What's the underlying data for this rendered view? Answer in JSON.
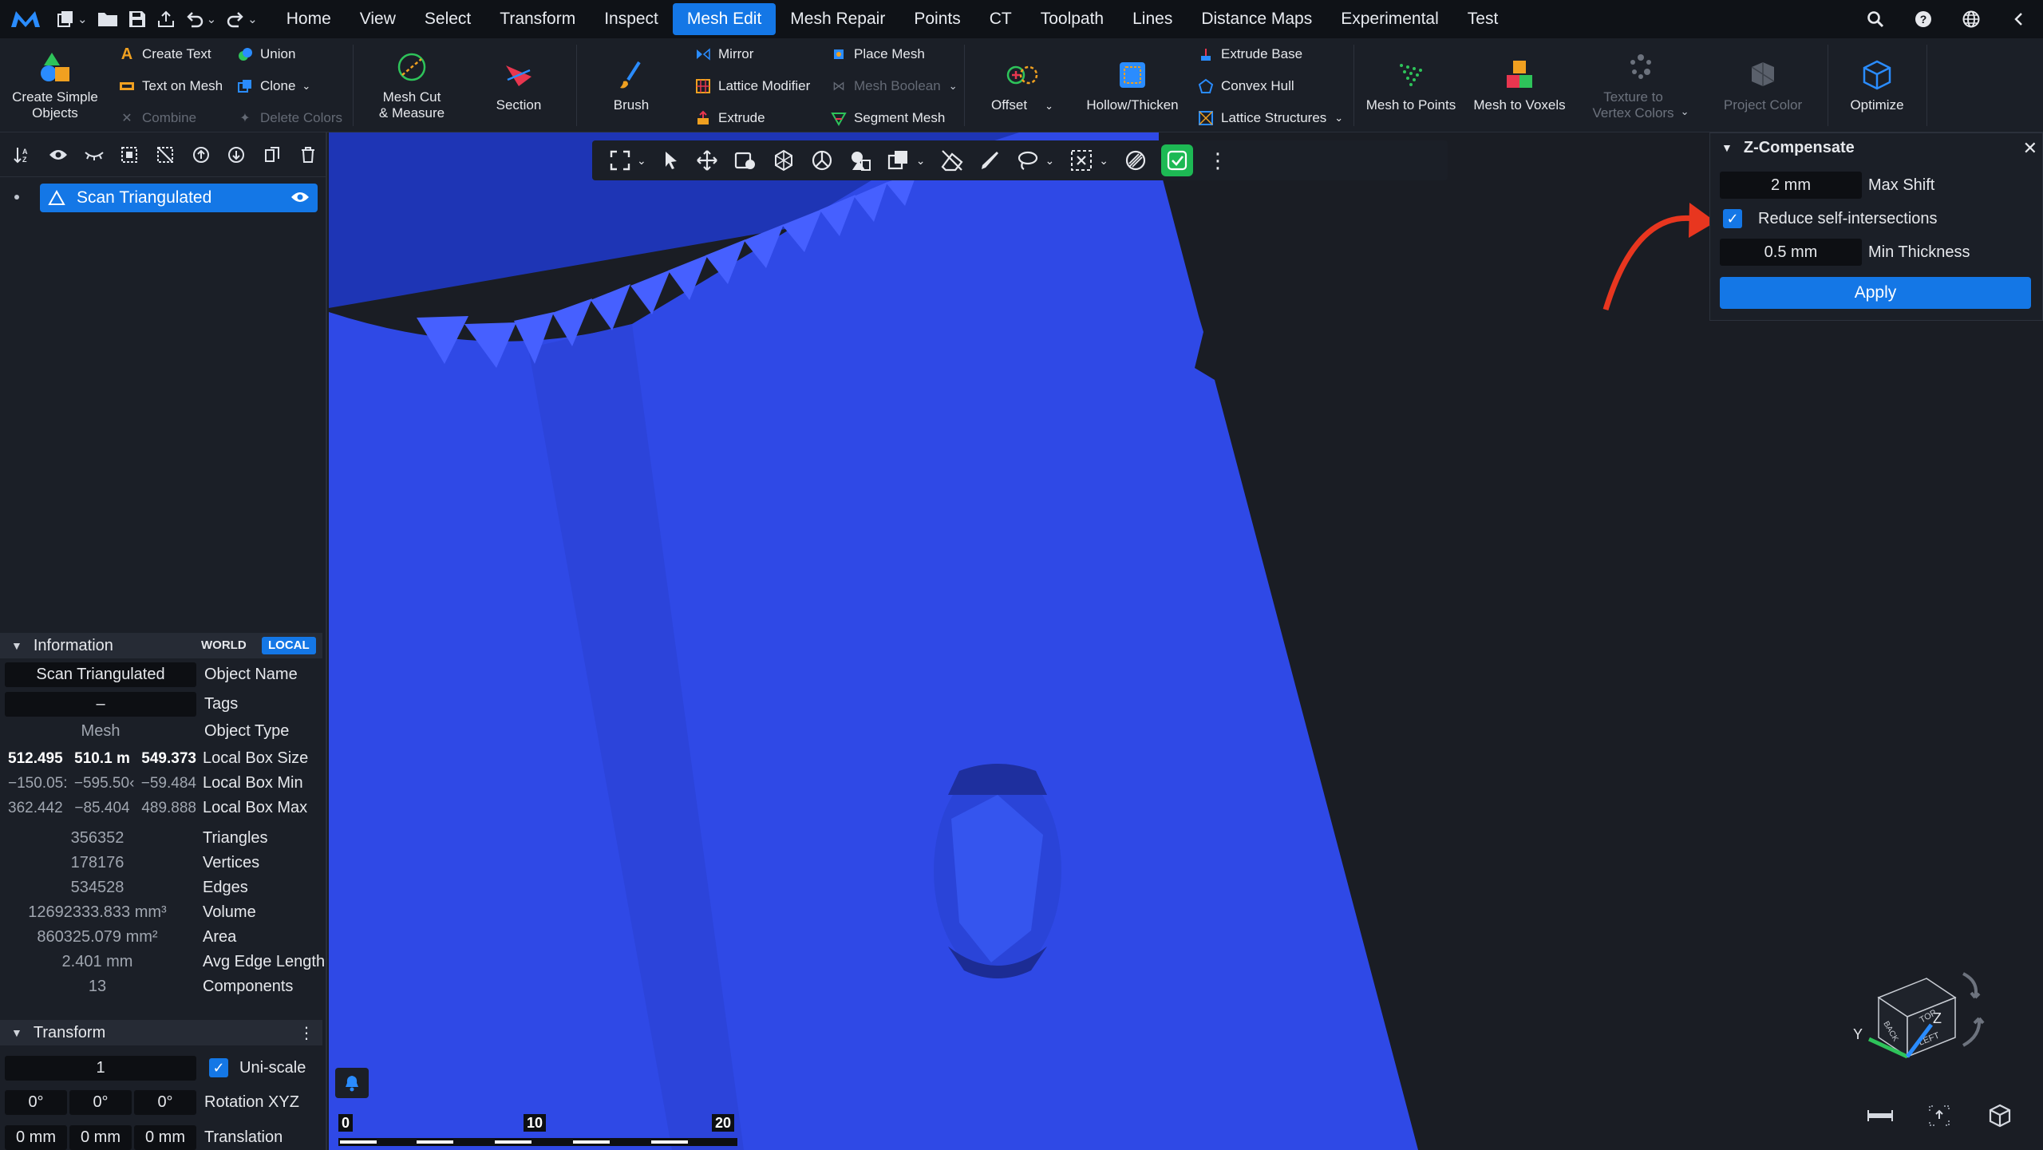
{
  "menu": {
    "tabs": [
      "Home",
      "View",
      "Select",
      "Transform",
      "Inspect",
      "Mesh Edit",
      "Mesh Repair",
      "Points",
      "CT",
      "Toolpath",
      "Lines",
      "Distance Maps",
      "Experimental",
      "Test"
    ],
    "active_tab": "Mesh Edit",
    "right_icons": [
      "search-icon",
      "help-icon",
      "globe-icon",
      "collapse-icon"
    ]
  },
  "ribbon": {
    "create_simple_objects": "Create Simple\nObjects",
    "create_text": "Create Text",
    "text_on_mesh": "Text on Mesh",
    "combine": "Combine",
    "union": "Union",
    "clone": "Clone",
    "delete_colors": "Delete Colors",
    "mesh_cut": "Mesh Cut\n& Measure",
    "section": "Section",
    "brush": "Brush",
    "mirror": "Mirror",
    "lattice_modifier": "Lattice Modifier",
    "extrude": "Extrude",
    "place_mesh": "Place Mesh",
    "mesh_boolean": "Mesh Boolean",
    "segment_mesh": "Segment Mesh",
    "offset": "Offset",
    "hollow_thicken": "Hollow/Thicken",
    "extrude_base": "Extrude Base",
    "convex_hull": "Convex Hull",
    "lattice_structures": "Lattice Structures",
    "mesh_to_points": "Mesh to Points",
    "mesh_to_voxels": "Mesh to Voxels",
    "texture_to_vertex_colors": "Texture to\nVertex Colors",
    "project_color": "Project Color",
    "optimize": "Optimize"
  },
  "scene": {
    "object_name": "Scan Triangulated"
  },
  "information": {
    "title": "Information",
    "world": "WORLD",
    "local": "LOCAL",
    "object_name_value": "Scan Triangulated",
    "object_name_label": "Object Name",
    "tags_value": "–",
    "tags_label": "Tags",
    "object_type_value": "Mesh",
    "object_type_label": "Object Type",
    "box_size": [
      "512.495",
      "510.1 m",
      "549.373"
    ],
    "box_size_label": "Local Box Size",
    "box_min": [
      "−150.05:",
      "−595.50‹",
      "−59.484"
    ],
    "box_min_label": "Local Box Min",
    "box_max": [
      "362.442",
      "−85.404",
      "489.888"
    ],
    "box_max_label": "Local Box Max",
    "triangles": "356352",
    "triangles_label": "Triangles",
    "vertices": "178176",
    "vertices_label": "Vertices",
    "edges": "534528",
    "edges_label": "Edges",
    "volume": "12692333.833 mm³",
    "volume_label": "Volume",
    "area": "860325.079 mm²",
    "area_label": "Area",
    "avg_edge": "2.401 mm",
    "avg_edge_label": "Avg Edge Length",
    "components": "13",
    "components_label": "Components"
  },
  "transform": {
    "title": "Transform",
    "scale": "1",
    "uniscale_label": "Uni-scale",
    "rotation": [
      "0°",
      "0°",
      "0°"
    ],
    "rotation_label": "Rotation XYZ",
    "translation": [
      "0 mm",
      "0 mm",
      "0 mm"
    ],
    "translation_label": "Translation"
  },
  "zcompensate": {
    "title": "Z-Compensate",
    "max_shift_value": "2 mm",
    "max_shift_label": "Max Shift",
    "reduce_label": "Reduce self-intersections",
    "reduce_checked": true,
    "min_thickness_value": "0.5 mm",
    "min_thickness_label": "Min Thickness",
    "apply_label": "Apply"
  },
  "scalebar": {
    "labels": [
      "0",
      "10",
      "20"
    ]
  },
  "viewcube": {
    "axis_y": "Y",
    "axis_z": "Z",
    "face_left": "LEFT",
    "face_top": "TOP",
    "face_back": "BACK"
  },
  "colors": {
    "accent": "#1477e6",
    "mesh_front": "#2f49e6",
    "mesh_top": "#1e35b5",
    "annotation_arrow": "#e8361f"
  }
}
